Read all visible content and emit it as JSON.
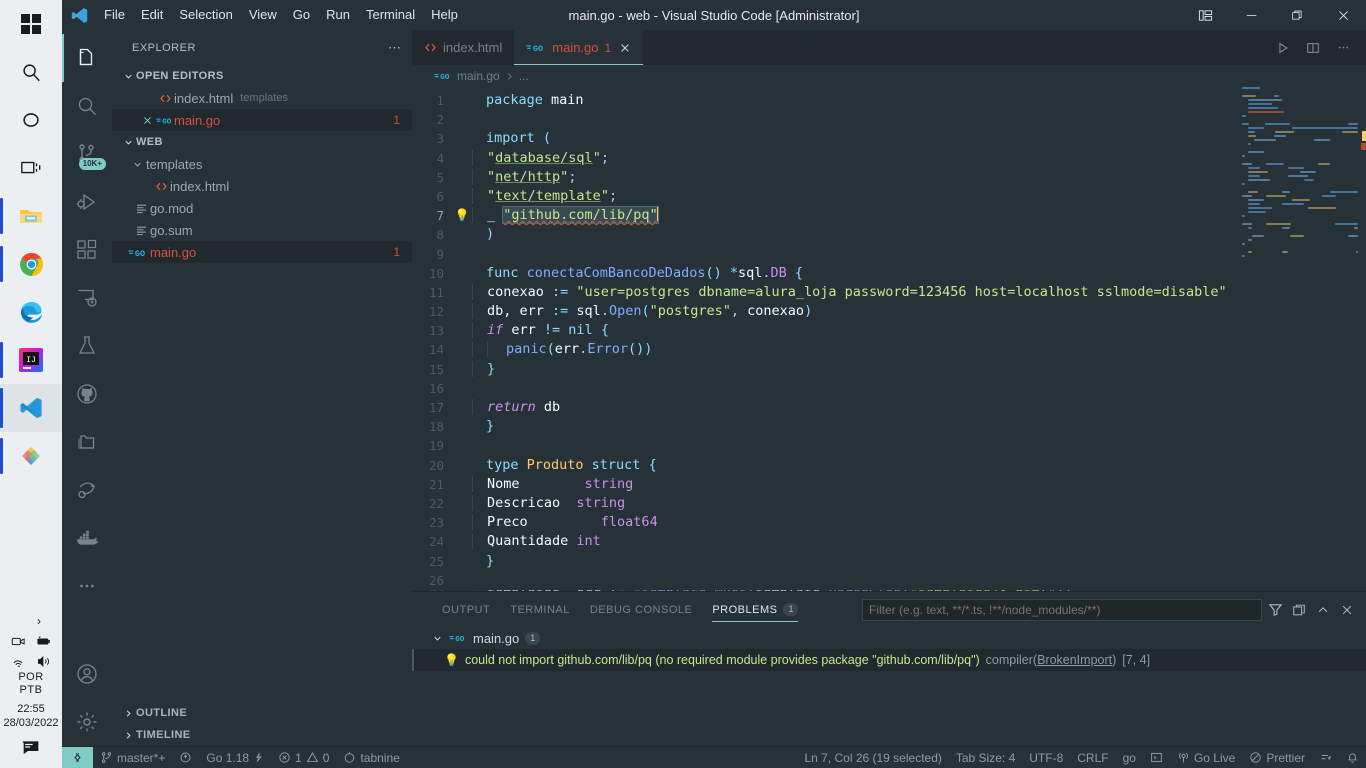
{
  "taskbar": {
    "items": [
      {
        "name": "start-button",
        "icon": "windows-logo"
      },
      {
        "name": "search-button",
        "icon": "search-icon"
      },
      {
        "name": "cortana-button",
        "icon": "circle-icon"
      },
      {
        "name": "task-view-button",
        "icon": "task-view-icon"
      },
      {
        "name": "file-explorer-button",
        "icon": "folder-icon"
      },
      {
        "name": "chrome-button",
        "icon": "chrome-icon"
      },
      {
        "name": "edge-button",
        "icon": "edge-icon"
      },
      {
        "name": "intellij-button",
        "icon": "intellij-icon"
      },
      {
        "name": "vscode-button",
        "icon": "vscode-icon"
      },
      {
        "name": "figma-button",
        "icon": "figma-icon"
      }
    ],
    "tray": {
      "chevron": "›",
      "language_line1": "POR",
      "language_line2": "PTB",
      "time": "22:55",
      "date": "28/03/2022"
    }
  },
  "titlebar": {
    "menu": [
      "File",
      "Edit",
      "Selection",
      "View",
      "Go",
      "Run",
      "Terminal",
      "Help"
    ],
    "title": "main.go - web - Visual Studio Code [Administrator]",
    "controls": {
      "layout": "customize-layout-icon",
      "minimize": "—",
      "maximize": "restore-icon",
      "close": "✕"
    }
  },
  "activitybar": {
    "items": [
      {
        "name": "explorer",
        "icon": "files-icon",
        "active": true,
        "badge": ""
      },
      {
        "name": "search",
        "icon": "search-icon",
        "active": false,
        "badge": ""
      },
      {
        "name": "source-control",
        "icon": "source-control-icon",
        "active": false,
        "badge": "10K+"
      },
      {
        "name": "run-and-debug",
        "icon": "debug-icon",
        "active": false,
        "badge": ""
      },
      {
        "name": "extensions",
        "icon": "extensions-icon",
        "active": false,
        "badge": ""
      },
      {
        "name": "remote-explorer",
        "icon": "remote-icon",
        "active": false,
        "badge": ""
      },
      {
        "name": "testing",
        "icon": "beaker-icon",
        "active": false,
        "badge": ""
      },
      {
        "name": "github",
        "icon": "github-icon",
        "active": false,
        "badge": ""
      },
      {
        "name": "project-manager",
        "icon": "folder-library-icon",
        "active": false,
        "badge": ""
      },
      {
        "name": "live-share",
        "icon": "live-share-icon",
        "active": false,
        "badge": ""
      },
      {
        "name": "docker",
        "icon": "docker-icon",
        "active": false,
        "badge": ""
      },
      {
        "name": "more-views",
        "icon": "ellipsis-icon",
        "active": false,
        "badge": ""
      }
    ],
    "bottom": [
      {
        "name": "accounts",
        "icon": "account-icon"
      },
      {
        "name": "manage-settings",
        "icon": "gear-icon"
      }
    ]
  },
  "sidebar": {
    "header": "EXPLORER",
    "header_actions": "⋯",
    "open_editors": {
      "title": "OPEN EDITORS",
      "items": [
        {
          "name": "index.html",
          "sub": "templates",
          "icon": "html-icon",
          "badge": "",
          "selected": false
        },
        {
          "name": "main.go",
          "sub": "",
          "icon": "go-icon",
          "badge": "1",
          "selected": true
        }
      ]
    },
    "workspace": {
      "title": "WEB",
      "items": [
        {
          "name": "templates",
          "icon": "folder-open-icon",
          "depth": 1,
          "badge": "",
          "selected": false,
          "type": "folder"
        },
        {
          "name": "index.html",
          "icon": "html-icon",
          "depth": 2,
          "badge": "",
          "selected": false,
          "type": "file"
        },
        {
          "name": "go.mod",
          "icon": "gomod-icon",
          "depth": 1,
          "badge": "",
          "selected": false,
          "type": "file"
        },
        {
          "name": "go.sum",
          "icon": "gomod-icon",
          "depth": 1,
          "badge": "",
          "selected": false,
          "type": "file"
        },
        {
          "name": "main.go",
          "icon": "go-icon",
          "depth": 1,
          "badge": "1",
          "selected": true,
          "type": "file"
        }
      ]
    },
    "collapsed_sections": [
      "OUTLINE",
      "TIMELINE"
    ]
  },
  "editor": {
    "tabs": [
      {
        "label": "index.html",
        "icon": "html-icon",
        "badge": "",
        "active": false,
        "closable": false
      },
      {
        "label": "main.go",
        "icon": "go-icon",
        "badge": "1",
        "active": true,
        "closable": true
      }
    ],
    "tab_actions": [
      {
        "name": "run-code-button",
        "icon": "play-icon"
      },
      {
        "name": "split-editor-button",
        "icon": "split-icon"
      },
      {
        "name": "more-actions-button",
        "icon": "ellipsis-icon"
      }
    ],
    "breadcrumb": [
      "main.go",
      "..."
    ],
    "code_lines": [
      {
        "n": 1,
        "bulb": false,
        "tokens": [
          [
            "kw2",
            "package "
          ],
          [
            "id",
            "main"
          ]
        ]
      },
      {
        "n": 2,
        "bulb": false,
        "tokens": []
      },
      {
        "n": 3,
        "bulb": false,
        "tokens": [
          [
            "kw2",
            "import "
          ],
          [
            "pun",
            "("
          ]
        ]
      },
      {
        "n": 4,
        "bulb": false,
        "indent": 1,
        "tokens": [
          [
            "str",
            "\""
          ],
          [
            "imp",
            "database/sql"
          ],
          [
            "str",
            "\""
          ],
          [
            "pun",
            ";"
          ]
        ]
      },
      {
        "n": 5,
        "bulb": false,
        "indent": 1,
        "tokens": [
          [
            "str",
            "\""
          ],
          [
            "imp",
            "net/http"
          ],
          [
            "str",
            "\""
          ],
          [
            "pun",
            ";"
          ]
        ]
      },
      {
        "n": 6,
        "bulb": false,
        "indent": 1,
        "tokens": [
          [
            "str",
            "\""
          ],
          [
            "imp",
            "text/template"
          ],
          [
            "str",
            "\""
          ],
          [
            "pun",
            ";"
          ]
        ]
      },
      {
        "n": 7,
        "bulb": true,
        "indent": 1,
        "current": true,
        "tokens": [
          [
            "id",
            "_ "
          ],
          [
            "selstr",
            "\"github.com/lib/pq\""
          ]
        ]
      },
      {
        "n": 8,
        "bulb": false,
        "tokens": [
          [
            "pun",
            ")"
          ]
        ]
      },
      {
        "n": 9,
        "bulb": false,
        "tokens": []
      },
      {
        "n": 10,
        "bulb": false,
        "tokens": [
          [
            "kw2",
            "func "
          ],
          [
            "fn",
            "conectaComBancoDeDados"
          ],
          [
            "pun",
            "() *"
          ],
          [
            "id",
            "sql"
          ],
          [
            "pun",
            "."
          ],
          [
            "typ2",
            "DB"
          ],
          [
            "pun",
            " {"
          ]
        ]
      },
      {
        "n": 11,
        "bulb": false,
        "indent": 1,
        "tokens": [
          [
            "id",
            "conexao "
          ],
          [
            "pun",
            ":= "
          ],
          [
            "str",
            "\"user=postgres dbname=alura_loja password=123456 host=localhost sslmode=disable\""
          ]
        ]
      },
      {
        "n": 12,
        "bulb": false,
        "indent": 1,
        "tokens": [
          [
            "id",
            "db, err "
          ],
          [
            "pun",
            ":= "
          ],
          [
            "id",
            "sql"
          ],
          [
            "pun",
            "."
          ],
          [
            "fn",
            "Open"
          ],
          [
            "pun",
            "("
          ],
          [
            "str",
            "\"postgres\""
          ],
          [
            "pun",
            ", "
          ],
          [
            "id",
            "conexao"
          ],
          [
            "pun",
            ")"
          ]
        ]
      },
      {
        "n": 13,
        "bulb": false,
        "indent": 1,
        "tokens": [
          [
            "kw",
            "if "
          ],
          [
            "id",
            "err "
          ],
          [
            "pun",
            "!= "
          ],
          [
            "kw2",
            "nil"
          ],
          [
            "pun",
            " {"
          ]
        ]
      },
      {
        "n": 14,
        "bulb": false,
        "indent": 2,
        "tokens": [
          [
            "fn",
            "panic"
          ],
          [
            "pun",
            "("
          ],
          [
            "id",
            "err"
          ],
          [
            "pun",
            "."
          ],
          [
            "fn",
            "Error"
          ],
          [
            "pun",
            "())"
          ]
        ]
      },
      {
        "n": 15,
        "bulb": false,
        "indent": 1,
        "tokens": [
          [
            "pun",
            "}"
          ]
        ]
      },
      {
        "n": 16,
        "bulb": false,
        "tokens": []
      },
      {
        "n": 17,
        "bulb": false,
        "indent": 1,
        "tokens": [
          [
            "kw",
            "return "
          ],
          [
            "id",
            "db"
          ]
        ]
      },
      {
        "n": 18,
        "bulb": false,
        "tokens": [
          [
            "pun",
            "}"
          ]
        ]
      },
      {
        "n": 19,
        "bulb": false,
        "tokens": []
      },
      {
        "n": 20,
        "bulb": false,
        "tokens": [
          [
            "kw2",
            "type "
          ],
          [
            "typ",
            "Produto "
          ],
          [
            "kw2",
            "struct"
          ],
          [
            "pun",
            " {"
          ]
        ]
      },
      {
        "n": 21,
        "bulb": false,
        "indent": 1,
        "tokens": [
          [
            "id",
            "Nome        "
          ],
          [
            "typ2",
            "string"
          ]
        ]
      },
      {
        "n": 22,
        "bulb": false,
        "indent": 1,
        "tokens": [
          [
            "id",
            "Descricao  "
          ],
          [
            "typ2",
            "string"
          ]
        ]
      },
      {
        "n": 23,
        "bulb": false,
        "indent": 1,
        "tokens": [
          [
            "id",
            "Preco         "
          ],
          [
            "typ2",
            "float64"
          ]
        ]
      },
      {
        "n": 24,
        "bulb": false,
        "indent": 1,
        "tokens": [
          [
            "id",
            "Quantidade "
          ],
          [
            "typ2",
            "int"
          ]
        ]
      },
      {
        "n": 25,
        "bulb": false,
        "tokens": [
          [
            "pun",
            "}"
          ]
        ]
      },
      {
        "n": 26,
        "bulb": false,
        "tokens": []
      }
    ]
  },
  "panel": {
    "tabs": [
      {
        "label": "OUTPUT",
        "badge": "",
        "active": false
      },
      {
        "label": "TERMINAL",
        "badge": "",
        "active": false
      },
      {
        "label": "DEBUG CONSOLE",
        "badge": "",
        "active": false
      },
      {
        "label": "PROBLEMS",
        "badge": "1",
        "active": true
      }
    ],
    "filter_placeholder": "Filter (e.g. text, **/*.ts, !**/node_modules/**)",
    "actions": [
      {
        "name": "filter-icon",
        "glyph": "filter"
      },
      {
        "name": "view-as-table-icon",
        "glyph": "table"
      },
      {
        "name": "collapse-panel-icon",
        "glyph": "chevron-up"
      },
      {
        "name": "close-panel-icon",
        "glyph": "close"
      }
    ],
    "problem_file": {
      "name": "main.go",
      "icon": "go-icon",
      "count": "1"
    },
    "problem_items": [
      {
        "icon": "lightbulb-icon",
        "message": "could not import github.com/lib/pq (no required module provides package \"github.com/lib/pq\")",
        "source": "compiler(",
        "source_link": "BrokenImport",
        "source_close": ")",
        "position": "[7, 4]"
      }
    ]
  },
  "statusbar": {
    "remote_icon": "remote-window-icon",
    "left": [
      {
        "name": "source-control-branch",
        "icon": "branch-icon",
        "label": "master*+"
      },
      {
        "name": "sync-changes",
        "icon": "sync-icon",
        "label": ""
      },
      {
        "name": "go-version",
        "icon": "",
        "label": "Go 1.18",
        "extra_icon": "go-gopher-icon"
      },
      {
        "name": "problems-count",
        "icon": "error-icon",
        "label": "1",
        "icon2": "warning-icon",
        "label2": "0"
      },
      {
        "name": "tabnine",
        "icon": "tabnine-icon",
        "label": "tabnine"
      }
    ],
    "right": [
      {
        "name": "cursor-position",
        "label": "Ln 7, Col 26 (19 selected)"
      },
      {
        "name": "tab-size",
        "label": "Tab Size: 4"
      },
      {
        "name": "encoding",
        "label": "UTF-8"
      },
      {
        "name": "eol",
        "label": "CRLF"
      },
      {
        "name": "language-mode",
        "label": "go"
      },
      {
        "name": "open-terminal",
        "label": "",
        "icon": "terminal-icon"
      },
      {
        "name": "go-live",
        "label": "Go Live",
        "icon": "broadcast-icon"
      },
      {
        "name": "prettier",
        "label": "Prettier",
        "icon": "prohibited-icon"
      },
      {
        "name": "live-share",
        "label": "",
        "icon": "live-share-icon"
      },
      {
        "name": "notifications",
        "label": "",
        "icon": "bell-icon"
      }
    ]
  },
  "minimap": {
    "accent": "#ffcb6b",
    "error": "#b04a3a"
  }
}
